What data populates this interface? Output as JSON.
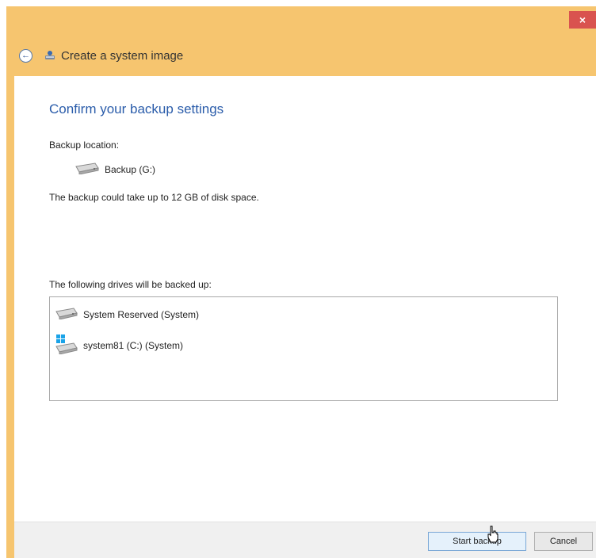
{
  "window": {
    "close_label": "×",
    "title": "Create a system image",
    "accent_color": "#f6c56f"
  },
  "content": {
    "heading": "Confirm your backup settings",
    "backup_location_label": "Backup location:",
    "backup_location_drive": "Backup (G:)",
    "disk_space_note": "The backup could take up to 12 GB of disk space.",
    "drives_label": "The following drives will be backed up:",
    "drives": [
      {
        "name": "System Reserved (System)",
        "icon": "hard-drive-icon"
      },
      {
        "name": "system81 (C:) (System)",
        "icon": "windows-drive-icon"
      }
    ]
  },
  "footer": {
    "start_label": "Start backup",
    "cancel_label": "Cancel"
  }
}
